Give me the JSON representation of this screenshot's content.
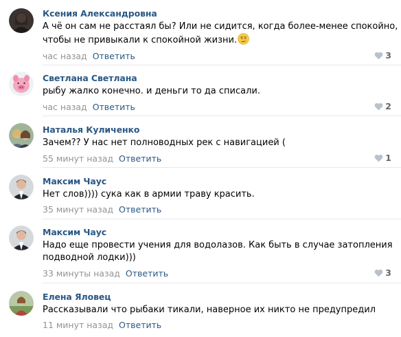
{
  "comments": [
    {
      "author": "Ксения Александровна",
      "lines": [
        "А чё он сам не расстаял бы? Или не сидится, когда более-менее спокойно,",
        "чтобы не привыкали к спокойной жизни."
      ],
      "emoji": "thinking-face-emoji",
      "time": "час назад",
      "reply": "Ответить",
      "likes": "3",
      "avatar": "avatar-woman-dark"
    },
    {
      "author": "Светлана Светлана",
      "lines": [
        "рыбу жалко конечно. и деньги то да списали."
      ],
      "time": "час назад",
      "reply": "Ответить",
      "likes": "2",
      "avatar": "avatar-pink-pig"
    },
    {
      "author": "Наталья Куличенко",
      "lines": [
        "Зачем?? У нас нет полноводных рек с навигацией ("
      ],
      "time": "55 минут назад",
      "reply": "Ответить",
      "likes": "1",
      "avatar": "avatar-two-women"
    },
    {
      "author": "Максим Чаус",
      "lines": [
        "Нет слов)))) сука как в армии траву красить."
      ],
      "time": "35 минут назад",
      "reply": "Ответить",
      "likes": "",
      "avatar": "avatar-man-suit"
    },
    {
      "author": "Максим Чаус",
      "lines": [
        "Надо еще провести учения для водолазов. Как быть в случае затопления",
        "подводной лодки)))"
      ],
      "time": "33 минуты назад",
      "reply": "Ответить",
      "likes": "3",
      "avatar": "avatar-man-suit"
    },
    {
      "author": "Елена Яловец",
      "lines": [
        "Рассказывали что рыбаки тикали, наверное их никто не предупредил"
      ],
      "time": "11 минут назад",
      "reply": "Ответить",
      "likes": "",
      "avatar": "avatar-woman-outdoor"
    }
  ],
  "colors": {
    "link": "#2a5885",
    "meta": "#939393",
    "separator": "#e7e8ec"
  }
}
